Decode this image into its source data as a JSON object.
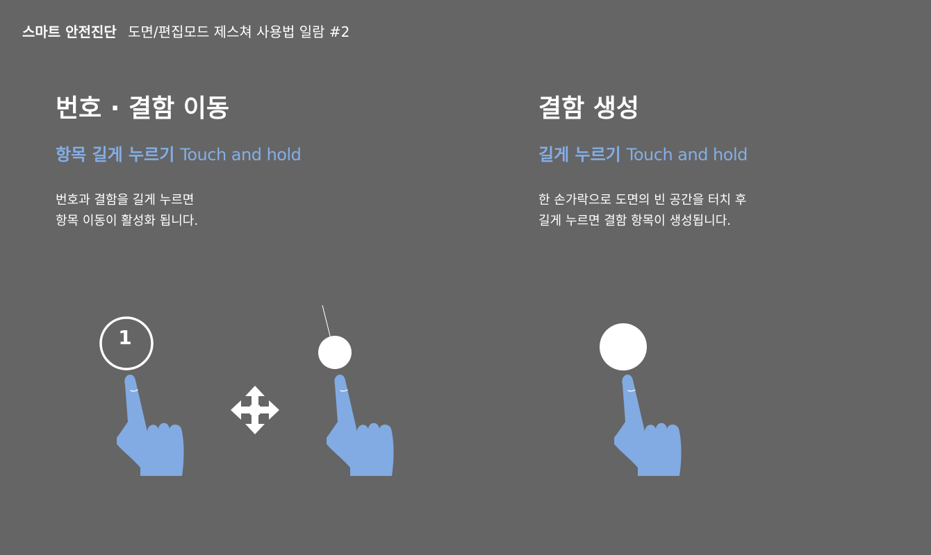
{
  "header": {
    "brand": "스마트 안전진단",
    "subtitle": "도면/편집모드 제스쳐 사용법 일람 #2"
  },
  "left": {
    "title": "번호 · 결함 이동",
    "subtitle_ko": "항목 길게 누르기",
    "subtitle_en": "Touch and hold",
    "desc": [
      "번호과 결함을 길게 누르면",
      "항목 이동이 활성화 됩니다."
    ],
    "marker_number": "1"
  },
  "right": {
    "title": "결함 생성",
    "subtitle_ko": "길게 누르기",
    "subtitle_en": "Touch and hold",
    "desc": [
      "한 손가락으로 도면의 빈 공간을 터치 후",
      "길게 누르면 결함 항목이 생성됩니다."
    ]
  },
  "colors": {
    "background": "#656565",
    "accent": "#84aee6",
    "hand": "#82abe3",
    "white": "#ffffff"
  },
  "icons": {
    "hand": "hand-pointer-icon",
    "move": "move-arrows-icon",
    "marker": "number-marker-icon",
    "dot": "touch-dot-icon"
  }
}
